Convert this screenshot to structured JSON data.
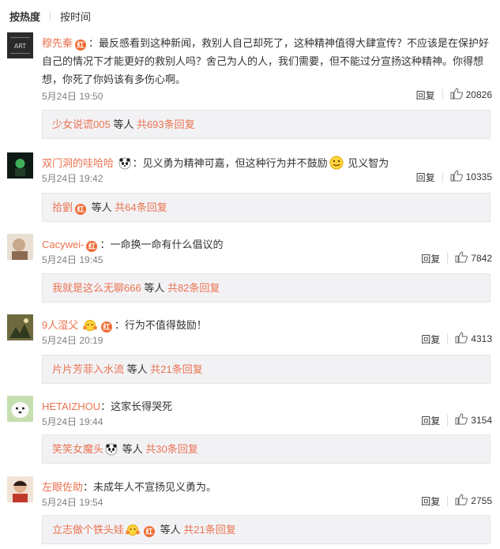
{
  "tabs": [
    {
      "label": "按热度",
      "active": true
    },
    {
      "label": "按时间",
      "active": false
    }
  ],
  "comments": [
    {
      "username": "穆先秦",
      "text": "：最反感看到这种新闻，救别人自己却死了，这种精神值得大肆宣传？不应该是在保护好自己的情况下才能更好的救别人吗？舍己为人的人，我们需要，但不能过分宣扬这种精神。你得想想，你死了你妈该有多伤心啊。",
      "time": "5月24日 19:50",
      "reply_label": "回复",
      "likes": "20826",
      "reply_user": "少女说谎005",
      "reply_mid": " 等人 ",
      "reply_count": "共693条回复"
    },
    {
      "username": "双门洞的哇哈哈",
      "text": "：见义勇为精神可嘉，但这种行为并不鼓励",
      "text2": " 见义智为",
      "time": "5月24日 19:42",
      "reply_label": "回复",
      "likes": "10335",
      "reply_user": "拾劉",
      "reply_mid": " 等人 ",
      "reply_count": "共64条回复"
    },
    {
      "username": "Cacywei-",
      "text": "：一命换一命有什么倡议的",
      "time": "5月24日 19:45",
      "reply_label": "回复",
      "likes": "7842",
      "reply_user": "我就是这么无聊666",
      "reply_mid": " 等人 ",
      "reply_count": "共82条回复"
    },
    {
      "username": "9人湿父",
      "text": "：行为不值得鼓励！",
      "time": "5月24日 20:19",
      "reply_label": "回复",
      "likes": "4313",
      "reply_user": "片片芳菲入水流",
      "reply_mid": " 等人 ",
      "reply_count": "共21条回复"
    },
    {
      "username": "HETAIZHOU",
      "text": "：这家长得哭死",
      "time": "5月24日 19:44",
      "reply_label": "回复",
      "likes": "3154",
      "reply_user": "笑笑女魔头",
      "reply_mid": " 等人 ",
      "reply_count": "共30条回复"
    },
    {
      "username": "左眼佐助",
      "text": "：未成年人不宣扬见义勇为。",
      "time": "5月24日 19:54",
      "reply_label": "回复",
      "likes": "2755",
      "reply_user": "立志做个铁头娃",
      "reply_mid": " 等人 ",
      "reply_count": "共21条回复"
    }
  ],
  "badge_glyph": "红",
  "colors": {
    "link": "#eb7350",
    "badge": "#f06d36",
    "meta": "#808080",
    "reply_box": "#f2f2f5"
  },
  "icons": [
    "like-icon",
    "panda-icon",
    "smile-emoji-icon",
    "hug-emoji-icon",
    "red-badge-icon"
  ]
}
